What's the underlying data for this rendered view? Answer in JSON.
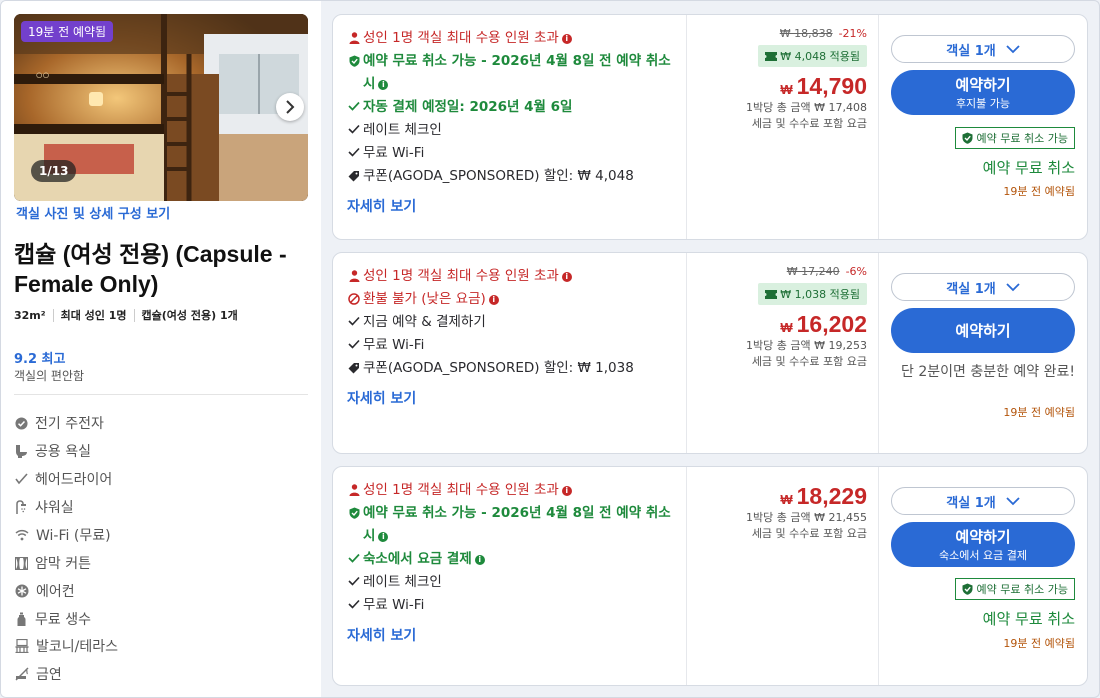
{
  "left": {
    "booked_badge": "19분 전 예약됨",
    "photo_counter": "1/13",
    "photo_link": "객실 사진 및 상세 구성 보기",
    "room_title": "캡슐 (여성 전용) (Capsule - Female Only)",
    "meta": [
      "32m²",
      "최대 성인 1명",
      "캡슐(여성 전용) 1개"
    ],
    "rating": "9.2 최고",
    "rating_sub": "객실의 편안함",
    "amenities": [
      {
        "icon": "check-circle-icon",
        "label": "전기 주전자"
      },
      {
        "icon": "toilet-icon",
        "label": "공용 욕실"
      },
      {
        "icon": "hairdryer-icon",
        "label": "헤어드라이어"
      },
      {
        "icon": "shower-icon",
        "label": "샤워실"
      },
      {
        "icon": "wifi-icon",
        "label": "Wi-Fi (무료)"
      },
      {
        "icon": "curtain-icon",
        "label": "암막 커튼"
      },
      {
        "icon": "snowflake-icon",
        "label": "에어컨"
      },
      {
        "icon": "bottle-icon",
        "label": "무료 생수"
      },
      {
        "icon": "balcony-icon",
        "label": "발코니/테라스"
      },
      {
        "icon": "no-smoking-icon",
        "label": "금연"
      }
    ]
  },
  "offers": [
    {
      "capacity": "성인 1명 객실 최대 수용 인원 초과",
      "policy": "예약 무료 취소 가능 - 2026년 4월 8일 전 예약 취소 시",
      "payment": "자동 결제 예정일: 2026년 4월 6일",
      "features": [
        "레이트 체크인",
        "무료 Wi-Fi"
      ],
      "coupon_line": "쿠폰(AGODA_SPONSORED) 할인: ₩ 4,048",
      "details": "자세히 보기",
      "original_price": "₩ 18,838",
      "discount": "-21%",
      "coupon_badge": "₩ 4,048 적용됨",
      "currency": "₩",
      "price": "14,790",
      "total": "1박당 총 금액 ₩ 17,408",
      "tax_note": "세금 및 수수료 포함 요금",
      "rooms": "객실 1개",
      "book": "예약하기",
      "book_sub": "후지불 가능",
      "free_badge": "예약 무료 취소 가능",
      "free_text": "예약 무료 취소",
      "booked": "19분 전 예약됨"
    },
    {
      "capacity": "성인 1명 객실 최대 수용 인원 초과",
      "policy": "환불 불가 (낮은 요금)",
      "features": [
        "지금 예약 & 결제하기",
        "무료 Wi-Fi"
      ],
      "coupon_line": "쿠폰(AGODA_SPONSORED) 할인: ₩ 1,038",
      "details": "자세히 보기",
      "original_price": "₩ 17,240",
      "discount": "-6%",
      "coupon_badge": "₩ 1,038 적용됨",
      "currency": "₩",
      "price": "16,202",
      "total": "1박당 총 금액 ₩ 19,253",
      "tax_note": "세금 및 수수료 포함 요금",
      "rooms": "객실 1개",
      "book": "예약하기",
      "quick": "단 2분이면 충분한 예약 완료!",
      "booked": "19분 전 예약됨"
    },
    {
      "capacity": "성인 1명 객실 최대 수용 인원 초과",
      "policy": "예약 무료 취소 가능 - 2026년 4월 8일 전 예약 취소 시",
      "payment": "숙소에서 요금 결제",
      "features": [
        "레이트 체크인",
        "무료 Wi-Fi"
      ],
      "details": "자세히 보기",
      "currency": "₩",
      "price": "18,229",
      "total": "1박당 총 금액 ₩ 21,455",
      "tax_note": "세금 및 수수료 포함 요금",
      "rooms": "객실 1개",
      "book": "예약하기",
      "book_sub": "숙소에서 요금 결제",
      "free_badge": "예약 무료 취소 가능",
      "free_text": "예약 무료 취소",
      "booked": "19분 전 예약됨"
    }
  ]
}
